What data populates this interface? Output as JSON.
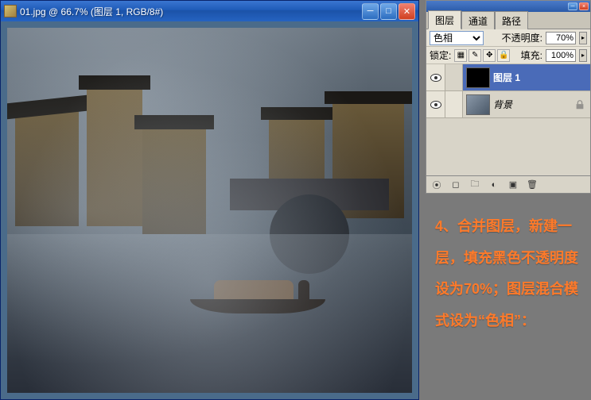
{
  "doc": {
    "title": "01.jpg @ 66.7% (图层 1, RGB/8#)"
  },
  "panel": {
    "tabs": {
      "layers": "图层",
      "channels": "通道",
      "paths": "路径"
    },
    "blend_mode": "色相",
    "opacity_label": "不透明度:",
    "opacity_value": "70%",
    "lock_label": "锁定:",
    "fill_label": "填充:",
    "fill_value": "100%",
    "layers": [
      {
        "name": "图层 1",
        "selected": true,
        "thumb": "black"
      },
      {
        "name": "背景",
        "selected": false,
        "thumb": "bg",
        "locked": true
      }
    ]
  },
  "instruction": {
    "text": "4、合并图层，新建一层，填充黑色不透明度设为70%；图层混合模式设为“色相”："
  }
}
